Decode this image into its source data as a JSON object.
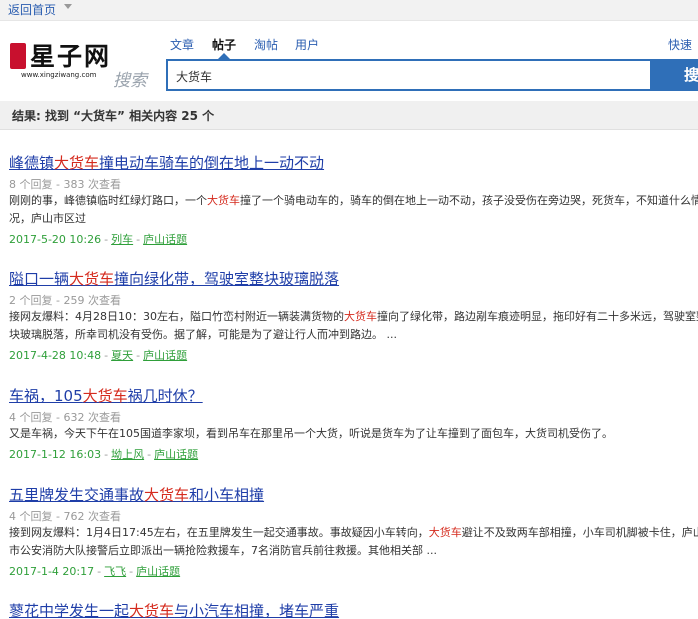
{
  "topbar": {
    "back_label": "返回首页"
  },
  "logo": {
    "name": "星子网",
    "domain": "www.xingziwang.com",
    "search_word": "搜索",
    "seal_text": "星子网"
  },
  "tabs": [
    {
      "label": "文章",
      "active": false
    },
    {
      "label": "帖子",
      "active": true
    },
    {
      "label": "淘帖",
      "active": false
    },
    {
      "label": "用户",
      "active": false
    }
  ],
  "quick_search_label": "快速",
  "search": {
    "value": "大货车",
    "button_label": "搜"
  },
  "result_summary": "结果: 找到 “大货车” 相关内容 25 个",
  "results": [
    {
      "title_pre": "峰德镇",
      "title_hl": "大货车",
      "title_post": "撞电动车骑车的倒在地上一动不动",
      "meta": "8 个回复 - 383 次查看",
      "snippet_pre": "刚刚的事，峰德镇临时红绿灯路口，一个",
      "snippet_hl": "大货车",
      "snippet_post": "撞了一个骑电动车的，骑车的倒在地上一动不动，孩子没受伤在旁边哭，死货车，不知道什么情况，庐山市区过",
      "date": "2017-5-20 10:26",
      "author": "列车",
      "forum": "庐山话题"
    },
    {
      "title_pre": "隘口一辆",
      "title_hl": "大货车",
      "title_post": "撞向绿化带，驾驶室整块玻璃脱落",
      "meta": "2 个回复 - 259 次查看",
      "snippet_pre": "接网友爆料：4月28日10：30左右，隘口竹峦村附近一辆装满货物的",
      "snippet_hl": "大货车",
      "snippet_post": "撞向了绿化带，路边剐车痕迹明显，拖印好有二十多米远，驾驶室整块玻璃脱落，所幸司机没有受伤。据了解，可能是为了避让行人而冲到路边。 ...",
      "date": "2017-4-28 10:48",
      "author": "夏天",
      "forum": "庐山话题"
    },
    {
      "title_pre": "车祸，105",
      "title_hl": "大货车",
      "title_post": "祸几时休？",
      "meta": "4 个回复 - 632 次查看",
      "snippet_pre": "又是车祸，今天下午在105国道李家坝，看到吊车在那里吊一个大货，听说是货车为了让车撞到了面包车，大货司机受伤了。",
      "snippet_hl": "",
      "snippet_post": "",
      "date": "2017-1-12 16:03",
      "author": "坳上风",
      "forum": "庐山话题"
    },
    {
      "title_pre": "五里牌发生交通事故",
      "title_hl": "大货车",
      "title_post": "和小车相撞",
      "meta": "4 个回复 - 762 次查看",
      "snippet_pre": "接到网友爆料：1月4日17:45左右，在五里牌发生一起交通事故。事故疑因小车转向，",
      "snippet_hl": "大货车",
      "snippet_post": "避让不及致两车部相撞，小车司机脚被卡住，庐山市公安消防大队接警后立即派出一辆抢险救援车，7名消防官兵前往救援。其他相关部 ...",
      "date": "2017-1-4 20:17",
      "author": "飞飞",
      "forum": "庐山话题"
    },
    {
      "title_pre": "蓼花中学发生一起",
      "title_hl": "大货车",
      "title_post": "与小汽车相撞，堵车严重",
      "meta": "",
      "snippet_pre": "",
      "snippet_hl": "",
      "snippet_post": "",
      "date": "",
      "author": "",
      "forum": ""
    }
  ]
}
